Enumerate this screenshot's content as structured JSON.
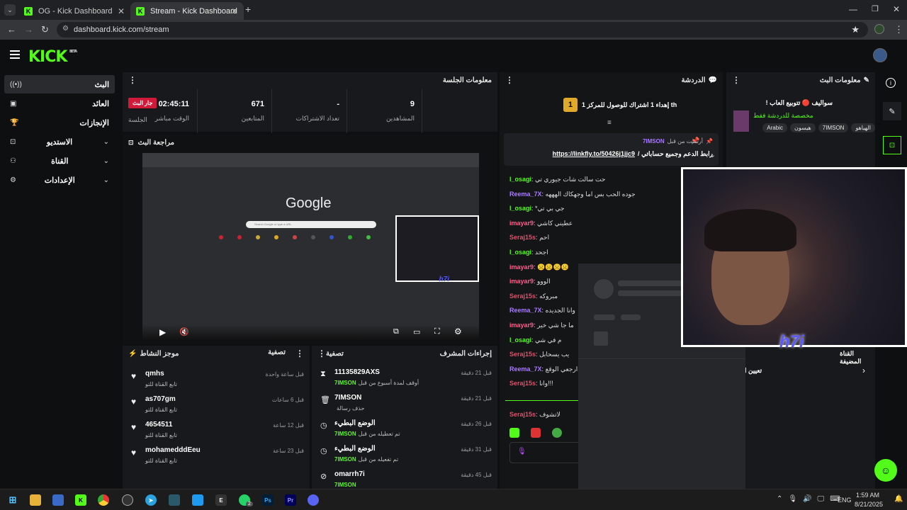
{
  "browser": {
    "tabs": [
      {
        "label": "OG - Kick Dashboard",
        "active": false
      },
      {
        "label": "Stream - Kick Dashboard",
        "active": true
      }
    ],
    "url": "dashboard.kick.com/stream"
  },
  "kick": {
    "logo": "KICK",
    "logo_tag": "BETA"
  },
  "sidebar": {
    "items": [
      {
        "label": "البث",
        "icon": "broadcast-icon"
      },
      {
        "label": "العائد",
        "icon": "dollar-icon"
      },
      {
        "label": "الإنجازات",
        "icon": "trophy-icon"
      },
      {
        "label": "الاستديو",
        "icon": "camera-icon"
      },
      {
        "label": "القناة",
        "icon": "users-icon"
      },
      {
        "label": "الإعدادات",
        "icon": "gear-icon"
      }
    ]
  },
  "session": {
    "title": "معلومات الجلسة",
    "live_badge": "جار البث",
    "session_label": "الجلسة",
    "stats": [
      {
        "value": "9",
        "label": "المشاهدين"
      },
      {
        "value": "671",
        "label": "المتابعين"
      },
      {
        "value": "-",
        "label": "تعداد الاشتراكات"
      },
      {
        "value": "02:45:11",
        "label": "الوقت مباشر"
      }
    ]
  },
  "preview": {
    "title": "مراجعة البث",
    "google_text": "Google",
    "search_placeholder": "Search Google or type a URL",
    "overlay_tag": "h7i"
  },
  "activity": {
    "title": "موجز النشاط",
    "filter": "تصفية",
    "items": [
      {
        "name": "qmhs",
        "sub": "تابع القناة للتو",
        "time": "قبل ساعة واحدة"
      },
      {
        "name": "as707gm",
        "sub": "تابع القناة للتو",
        "time": "قبل 6 ساعات"
      },
      {
        "name": "4654511",
        "sub": "تابع القناة للتو",
        "time": "قبل 12 ساعة"
      },
      {
        "name": "mohameddd​Eeu",
        "sub": "تابع القناة للتو",
        "time": "قبل 23 ساعة"
      }
    ]
  },
  "modactions": {
    "title": "إجراءات المشرف",
    "filter": "تصفية",
    "items": [
      {
        "name": "11135829AXS",
        "sub": "أوقف لمدة أسبوع من قبل",
        "by": "7IMSON",
        "time": "قبل 21 دقيقة"
      },
      {
        "name": "7IMSON",
        "sub": "حذف رسالة",
        "by": "",
        "time": "قبل 21 دقيقة"
      },
      {
        "name": "الوضع البطيء",
        "sub": "تم تعطيله من قبل",
        "by": "7IMSON",
        "time": "قبل 26 دقيقة"
      },
      {
        "name": "الوضع البطيء",
        "sub": "تم تفعيله من قبل",
        "by": "7IMSON",
        "time": "قبل 31 دقيقة"
      },
      {
        "name": "omarrh7i",
        "sub": "",
        "by": "7IMSON",
        "time": "قبل 45 دقيقة"
      }
    ]
  },
  "chat": {
    "title": "الدردشة",
    "goal_rank": "1",
    "goal_text": "إهداء 1 اشتراك للوصول للمركز 1 th",
    "pinned_by": "أرسلت من قبل",
    "pinned_user": "7IMSON",
    "pinned_link": "https://linkfly.to/50426j1jjc9",
    "pinned_text": "/ رابط الدعم وجميع حساباتي",
    "messages": [
      {
        "user": "l_osagi",
        "color": "#53fc18",
        "text": "حت سالت شات جيوري تي"
      },
      {
        "user": "Reema_7X",
        "color": "#a97bff",
        "text": "جوده الحب بس اما وجهكاك الهههه"
      },
      {
        "user": "l_osagi",
        "color": "#53fc18",
        "text": "*جي بي تي"
      },
      {
        "user": "imayar9",
        "color": "#ff5c8a",
        "text": "عطيني كاشي"
      },
      {
        "user": "Seraj15s",
        "color": "#e0506b",
        "text": "احم"
      },
      {
        "user": "l_osagi",
        "color": "#53fc18",
        "text": "اجحد"
      },
      {
        "user": "imayar9",
        "color": "#ff5c8a",
        "text": "☹️☹️☹️☹️"
      },
      {
        "user": "imayar9",
        "color": "#ff5c8a",
        "text": "الووو"
      },
      {
        "user": "Seraj15s",
        "color": "#e0506b",
        "text": "مبروكه"
      },
      {
        "user": "Reema_7X",
        "color": "#a97bff",
        "text": "وانا الجديده"
      },
      {
        "user": "imayar9",
        "color": "#ff5c8a",
        "text": "ما جا شي خير"
      },
      {
        "user": "l_osagi",
        "color": "#53fc18",
        "text": "م في شي"
      },
      {
        "user": "Seraj15s",
        "color": "#e0506b",
        "text": "يب يسحابل"
      },
      {
        "user": "Reema_7X",
        "color": "#a97bff",
        "text": "و ارجعي الوقع"
      },
      {
        "user": "Seraj15s",
        "color": "#e0506b",
        "text": "وانا!!!"
      },
      {
        "user": "Seraj15s",
        "color": "#e0506b",
        "text": "لاتشوف"
      }
    ]
  },
  "streaminfo": {
    "title": "معلومات البث",
    "stream_title": "!  سواليف 🔴 تتوبيع العاب",
    "category": "مخصصة للدردشة فقط",
    "tags": [
      "الهياهو",
      "7IMSON",
      "هيسون",
      "Arabic"
    ],
    "quick_label": "القناة المضيفة",
    "quick_text": "تعيين ا"
  },
  "webcam": {
    "tag": "h7i"
  },
  "taskbar": {
    "lang": "ENG",
    "time": "1:59 AM",
    "date": "8/21/2025",
    "badge": "2"
  }
}
